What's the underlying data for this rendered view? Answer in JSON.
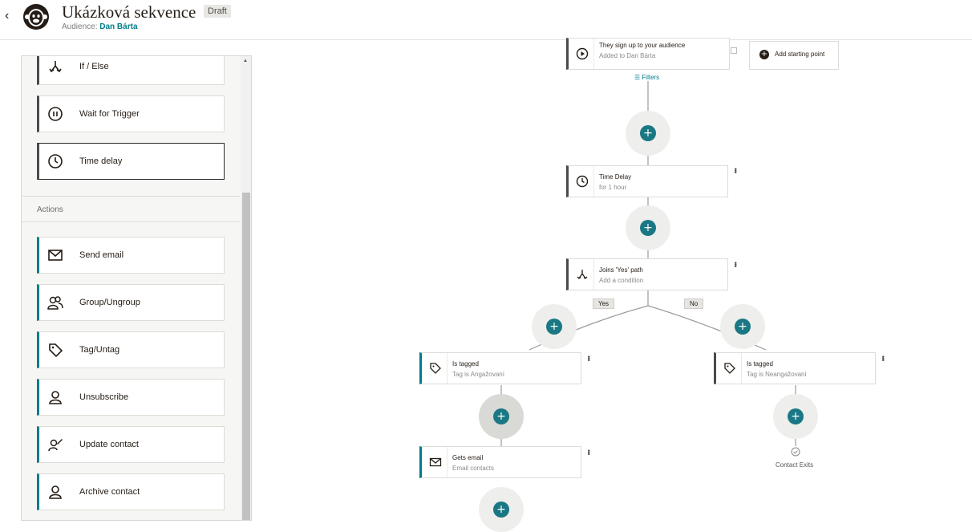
{
  "header": {
    "back_glyph": "‹",
    "title": "Ukázková sekvence",
    "status_badge": "Draft",
    "audience_label": "Audience:",
    "audience_name": "Dan Bárta"
  },
  "sidebar": {
    "triggers": [
      {
        "label": "If / Else",
        "icon": "split-icon"
      },
      {
        "label": "Wait for Trigger",
        "icon": "pause-icon"
      },
      {
        "label": "Time delay",
        "icon": "clock-icon"
      }
    ],
    "actions_heading": "Actions",
    "actions": [
      {
        "label": "Send email",
        "icon": "envelope-icon"
      },
      {
        "label": "Group/Ungroup",
        "icon": "group-icon"
      },
      {
        "label": "Tag/Untag",
        "icon": "tag-icon"
      },
      {
        "label": "Unsubscribe",
        "icon": "person-icon"
      },
      {
        "label": "Update contact",
        "icon": "edit-person-icon"
      },
      {
        "label": "Archive contact",
        "icon": "person-icon"
      }
    ]
  },
  "flow": {
    "trigger": {
      "title": "They sign up to your audience",
      "subtitle": "Added to Dan Bárta"
    },
    "filters_label": "Filters",
    "add_starting_point": "Add starting point",
    "time_delay": {
      "title": "Time Delay",
      "subtitle": "for 1 hour"
    },
    "condition": {
      "title": "Joins 'Yes' path",
      "subtitle": "Add a condition"
    },
    "yes_label": "Yes",
    "no_label": "No",
    "tagged_yes": {
      "title": "Is tagged",
      "subtitle": "Tag is Angažovaní"
    },
    "tagged_no": {
      "title": "Is tagged",
      "subtitle": "Tag is Neangažovaní"
    },
    "gets_email": {
      "title": "Gets email",
      "subtitle": "Email contacts"
    },
    "contact_exits": "Contact Exits",
    "plus_glyph": "+"
  },
  "colors": {
    "accent": "#007c89",
    "plus": "#1a7884",
    "dark": "#241c15"
  }
}
